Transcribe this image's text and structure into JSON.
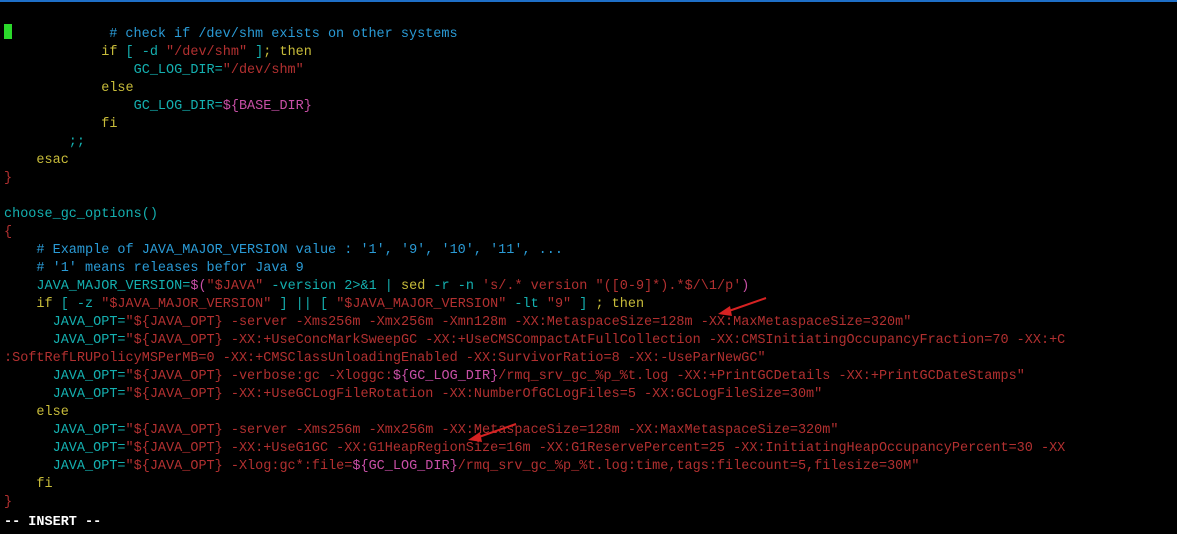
{
  "lines": {
    "l1": "            # check if /dev/shm exists on other systems",
    "l2a": "            if",
    "l2b": " [ ",
    "l2c": "-d ",
    "l2d": "\"/dev/shm\"",
    "l2e": " ]",
    "l2f": "; then",
    "l3a": "                GC_LOG_DIR=",
    "l3b": "\"/dev/shm\"",
    "l4": "            else",
    "l5a": "                GC_LOG_DIR=",
    "l5b": "${BASE_DIR}",
    "l6": "            fi",
    "l7": "        ;;",
    "l8": "    esac",
    "l9": "}",
    "l10": "",
    "l11a": "choose_gc_options",
    "l11b": "()",
    "l12": "{",
    "l13": "    # Example of JAVA_MAJOR_VERSION value : '1', '9', '10', '11', ...",
    "l14": "    # '1' means releases befor Java 9",
    "l15a": "    JAVA_MAJOR_VERSION=",
    "l15b": "$(",
    "l15c": "\"$JAVA\"",
    "l15d": " -version ",
    "l15e": "2",
    "l15f": ">&",
    "l15g": "1",
    "l15h": " | ",
    "l15i": "sed",
    "l15j": " -r -n ",
    "l15k": "'s/.* version \"([0-9]*).*$/\\1/p'",
    "l15l": ")",
    "l16a": "    if",
    "l16b": " [ ",
    "l16c": "-z ",
    "l16d": "\"$JAVA_MAJOR_VERSION\"",
    "l16e": " ] || [ ",
    "l16f": "\"$JAVA_MAJOR_VERSION\"",
    "l16g": " -lt ",
    "l16h": "\"9\"",
    "l16i": " ] ",
    "l16j": "; then",
    "l17a": "      JAVA_OPT=",
    "l17b": "\"${JAVA_OPT}",
    "l17c": " -server -Xms256m -Xmx256m -Xmn128m -XX:MetaspaceSize=128m -XX:MaxMetaspaceSize=320m",
    "l17d": "\"",
    "l18a": "      JAVA_OPT=",
    "l18b": "\"${JAVA_OPT}",
    "l18c": " -XX:+UseConcMarkSweepGC -XX:+UseCMSCompactAtFullCollection -XX:CMSInitiatingOccupancyFraction=70 -XX:+C",
    "l19": ":SoftRefLRUPolicyMSPerMB=0 -XX:+CMSClassUnloadingEnabled -XX:SurvivorRatio=8 -XX:-UseParNewGC",
    "l19d": "\"",
    "l20a": "      JAVA_OPT=",
    "l20b": "\"${JAVA_OPT}",
    "l20c": " -verbose:gc -Xloggc:",
    "l20d": "${GC_LOG_DIR}",
    "l20e": "/rmq_srv_gc_%p_%t.log -XX:+PrintGCDetails -XX:+PrintGCDateStamps",
    "l20f": "\"",
    "l21a": "      JAVA_OPT=",
    "l21b": "\"${JAVA_OPT}",
    "l21c": " -XX:+UseGCLogFileRotation -XX:NumberOfGCLogFiles=5 -XX:GCLogFileSize=30m",
    "l21d": "\"",
    "l22": "    else",
    "l23a": "      JAVA_OPT=",
    "l23b": "\"${JAVA_OPT}",
    "l23c": " -server -Xms256m -Xmx256m",
    "l23d": " -XX:MetaspaceSize=128m -XX:MaxMetaspaceSize=320m",
    "l23e": "\"",
    "l24a": "      JAVA_OPT=",
    "l24b": "\"${JAVA_OPT}",
    "l24c": " -XX:+UseG1GC -XX:G1HeapRegionSize=16m -XX:G1ReservePercent=25 -XX:InitiatingHeapOccupancyPercent=30 -XX",
    "l25a": "      JAVA_OPT=",
    "l25b": "\"${JAVA_OPT}",
    "l25c": " -Xlog:gc*:file=",
    "l25d": "${GC_LOG_DIR}",
    "l25e": "/rmq_srv_gc_%p_%t.log:time,tags:filecount=5,filesize=30M",
    "l25f": "\"",
    "l26": "    fi",
    "l27": "}"
  },
  "status": "-- INSERT --"
}
